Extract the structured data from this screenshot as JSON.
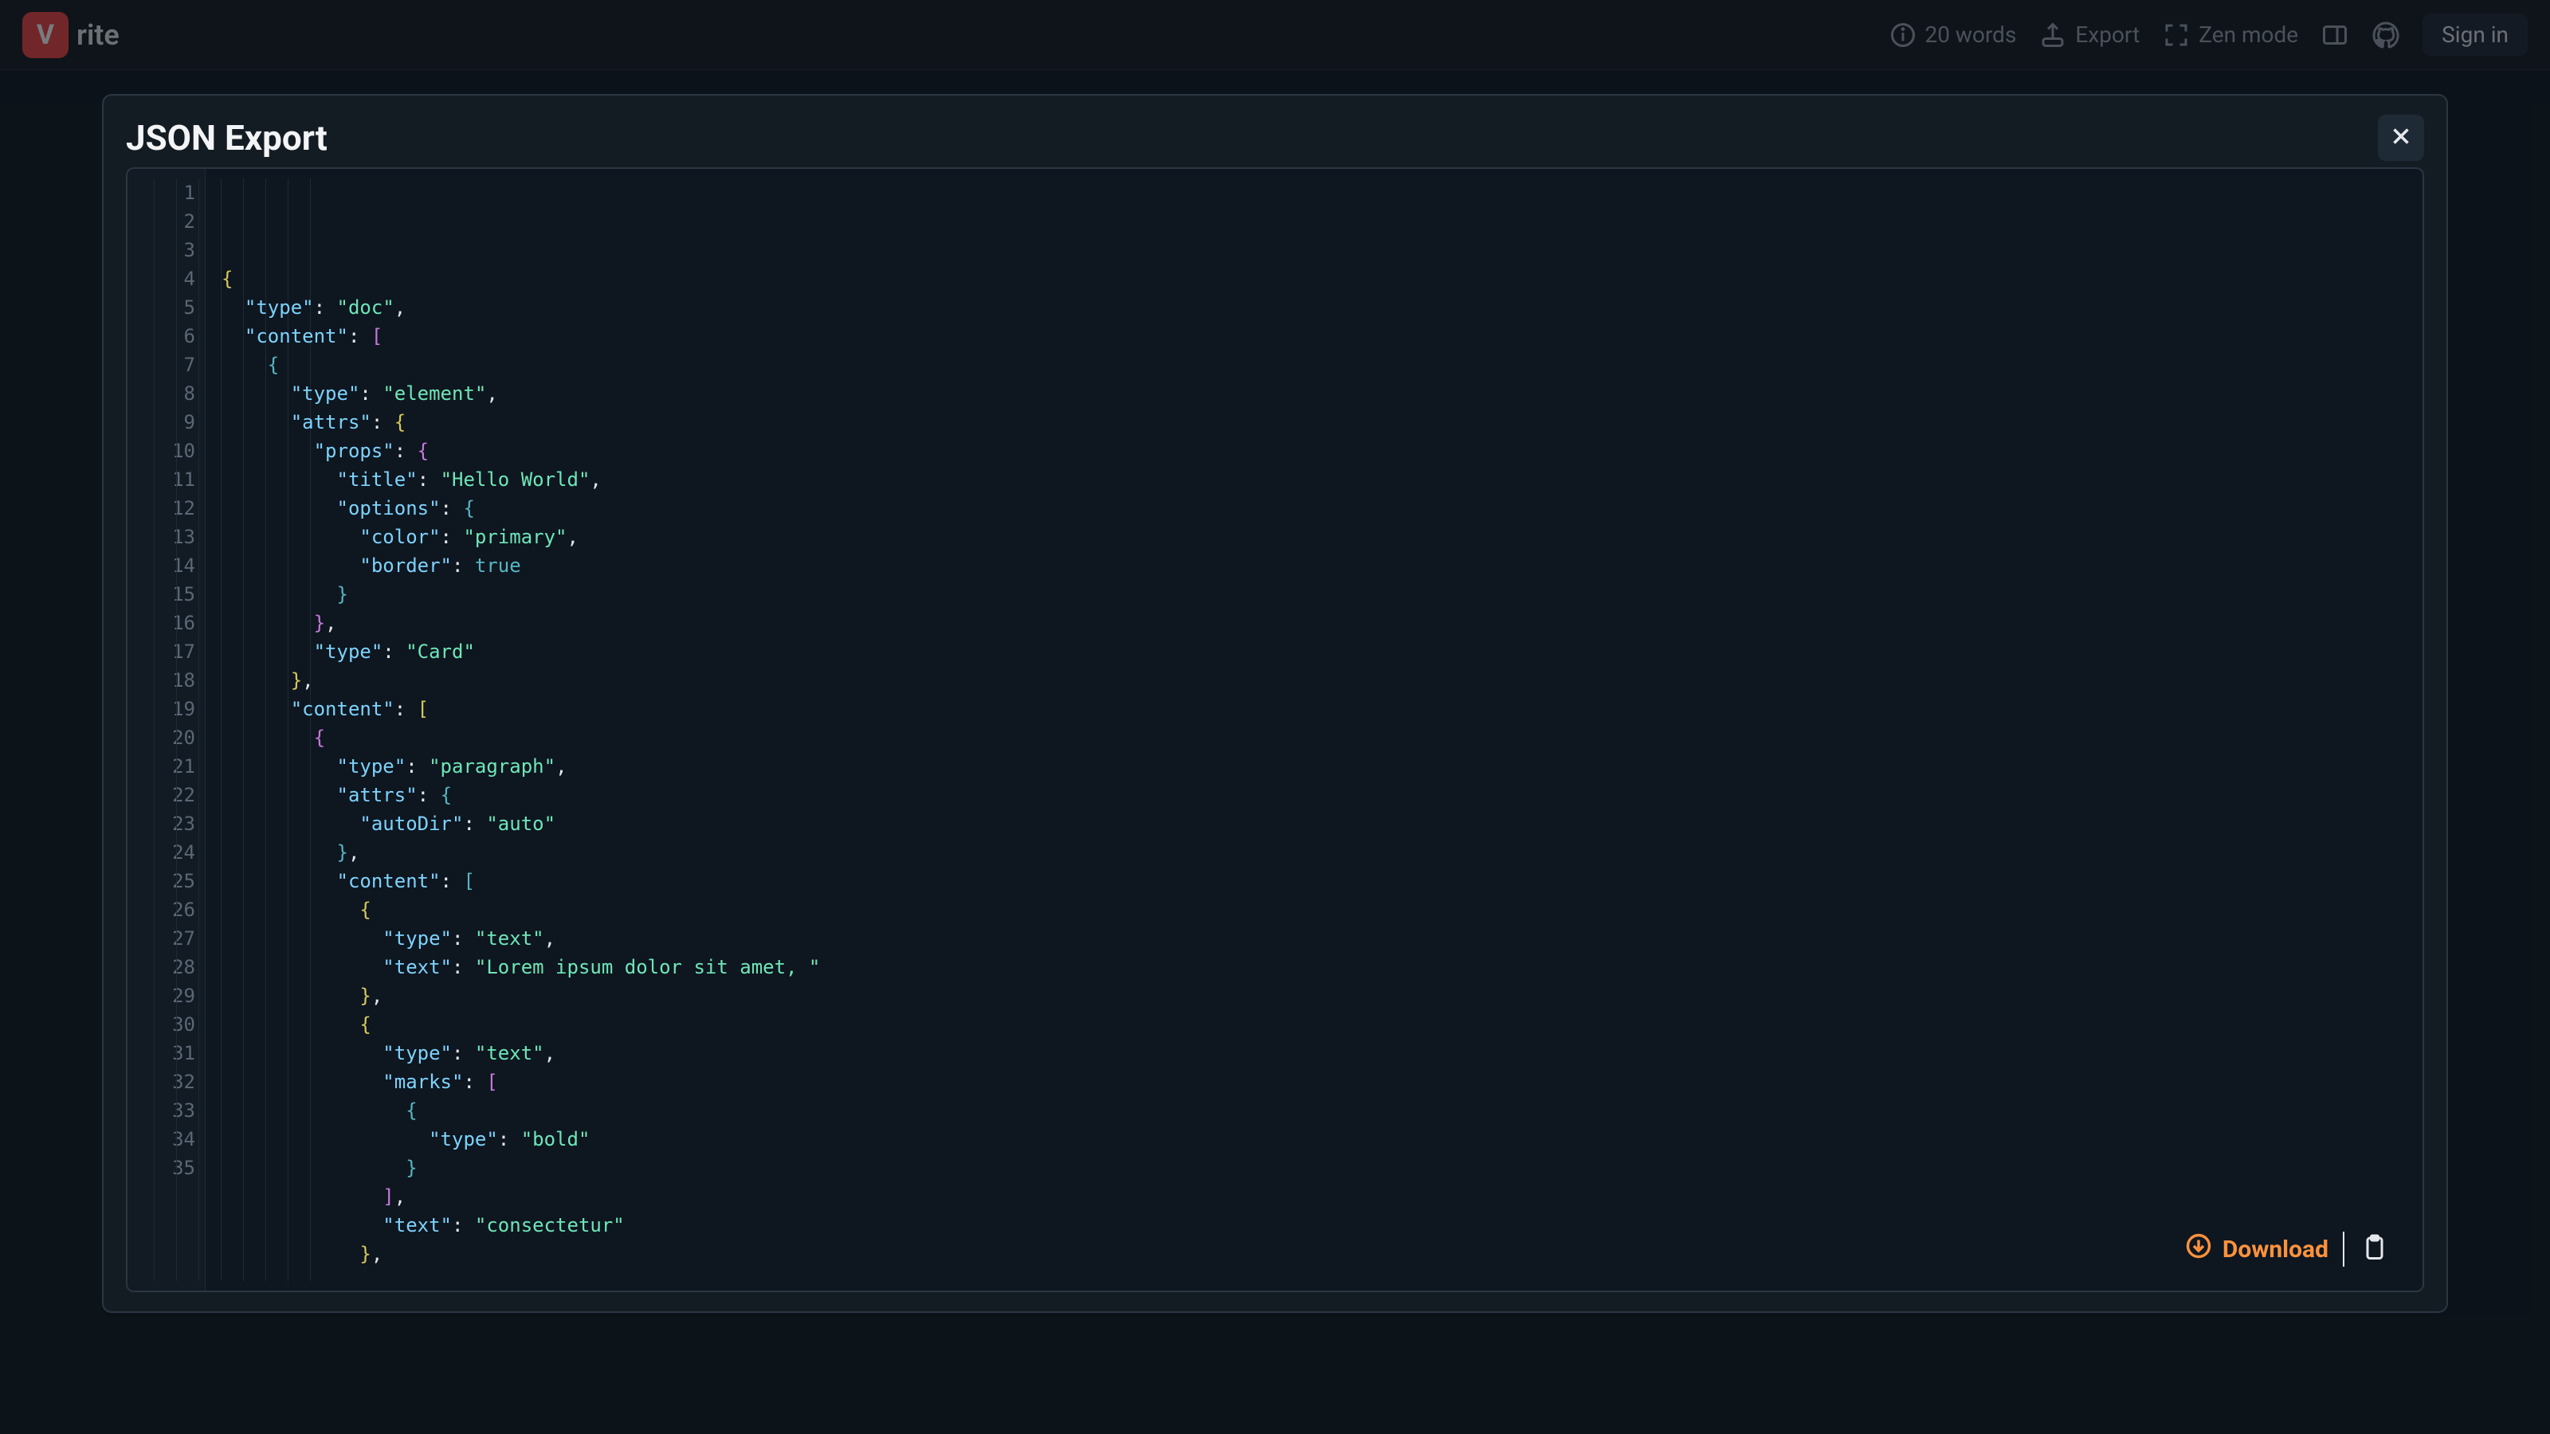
{
  "header": {
    "logo_letter": "V",
    "logo_text": "rite",
    "word_count": "20 words",
    "export_label": "Export",
    "zen_label": "Zen mode",
    "signin_label": "Sign in"
  },
  "modal": {
    "title": "JSON Export",
    "download_label": "Download"
  },
  "code": {
    "line_numbers": [
      "1",
      "2",
      "3",
      "4",
      "5",
      "6",
      "7",
      "8",
      "9",
      "10",
      "11",
      "12",
      "13",
      "14",
      "15",
      "16",
      "17",
      "18",
      "19",
      "20",
      "21",
      "22",
      "23",
      "24",
      "25",
      "26",
      "27",
      "28",
      "29",
      "30",
      "31",
      "32",
      "33",
      "34",
      "35"
    ],
    "lines": [
      [
        {
          "t": "{",
          "c": "brace"
        }
      ],
      [
        {
          "t": "  ",
          "c": "p"
        },
        {
          "t": "\"type\"",
          "c": "key"
        },
        {
          "t": ": ",
          "c": "punct"
        },
        {
          "t": "\"doc\"",
          "c": "str"
        },
        {
          "t": ",",
          "c": "punct"
        }
      ],
      [
        {
          "t": "  ",
          "c": "p"
        },
        {
          "t": "\"content\"",
          "c": "key"
        },
        {
          "t": ": ",
          "c": "punct"
        },
        {
          "t": "[",
          "c": "bracket"
        }
      ],
      [
        {
          "t": "    ",
          "c": "p"
        },
        {
          "t": "{",
          "c": "brace3"
        }
      ],
      [
        {
          "t": "      ",
          "c": "p"
        },
        {
          "t": "\"type\"",
          "c": "key"
        },
        {
          "t": ": ",
          "c": "punct"
        },
        {
          "t": "\"element\"",
          "c": "str"
        },
        {
          "t": ",",
          "c": "punct"
        }
      ],
      [
        {
          "t": "      ",
          "c": "p"
        },
        {
          "t": "\"attrs\"",
          "c": "key"
        },
        {
          "t": ": ",
          "c": "punct"
        },
        {
          "t": "{",
          "c": "brace"
        }
      ],
      [
        {
          "t": "        ",
          "c": "p"
        },
        {
          "t": "\"props\"",
          "c": "key"
        },
        {
          "t": ": ",
          "c": "punct"
        },
        {
          "t": "{",
          "c": "brace2"
        }
      ],
      [
        {
          "t": "          ",
          "c": "p"
        },
        {
          "t": "\"title\"",
          "c": "key"
        },
        {
          "t": ": ",
          "c": "punct"
        },
        {
          "t": "\"Hello World\"",
          "c": "str"
        },
        {
          "t": ",",
          "c": "punct"
        }
      ],
      [
        {
          "t": "          ",
          "c": "p"
        },
        {
          "t": "\"options\"",
          "c": "key"
        },
        {
          "t": ": ",
          "c": "punct"
        },
        {
          "t": "{",
          "c": "brace3"
        }
      ],
      [
        {
          "t": "            ",
          "c": "p"
        },
        {
          "t": "\"color\"",
          "c": "key"
        },
        {
          "t": ": ",
          "c": "punct"
        },
        {
          "t": "\"primary\"",
          "c": "str"
        },
        {
          "t": ",",
          "c": "punct"
        }
      ],
      [
        {
          "t": "            ",
          "c": "p"
        },
        {
          "t": "\"border\"",
          "c": "key"
        },
        {
          "t": ": ",
          "c": "punct"
        },
        {
          "t": "true",
          "c": "bool"
        }
      ],
      [
        {
          "t": "          ",
          "c": "p"
        },
        {
          "t": "}",
          "c": "brace3"
        }
      ],
      [
        {
          "t": "        ",
          "c": "p"
        },
        {
          "t": "}",
          "c": "brace2"
        },
        {
          "t": ",",
          "c": "punct"
        }
      ],
      [
        {
          "t": "        ",
          "c": "p"
        },
        {
          "t": "\"type\"",
          "c": "key"
        },
        {
          "t": ": ",
          "c": "punct"
        },
        {
          "t": "\"Card\"",
          "c": "str"
        }
      ],
      [
        {
          "t": "      ",
          "c": "p"
        },
        {
          "t": "}",
          "c": "brace"
        },
        {
          "t": ",",
          "c": "punct"
        }
      ],
      [
        {
          "t": "      ",
          "c": "p"
        },
        {
          "t": "\"content\"",
          "c": "key"
        },
        {
          "t": ": ",
          "c": "punct"
        },
        {
          "t": "[",
          "c": "brace"
        }
      ],
      [
        {
          "t": "        ",
          "c": "p"
        },
        {
          "t": "{",
          "c": "brace2"
        }
      ],
      [
        {
          "t": "          ",
          "c": "p"
        },
        {
          "t": "\"type\"",
          "c": "key"
        },
        {
          "t": ": ",
          "c": "punct"
        },
        {
          "t": "\"paragraph\"",
          "c": "str"
        },
        {
          "t": ",",
          "c": "punct"
        }
      ],
      [
        {
          "t": "          ",
          "c": "p"
        },
        {
          "t": "\"attrs\"",
          "c": "key"
        },
        {
          "t": ": ",
          "c": "punct"
        },
        {
          "t": "{",
          "c": "brace3"
        }
      ],
      [
        {
          "t": "            ",
          "c": "p"
        },
        {
          "t": "\"autoDir\"",
          "c": "key"
        },
        {
          "t": ": ",
          "c": "punct"
        },
        {
          "t": "\"auto\"",
          "c": "str"
        }
      ],
      [
        {
          "t": "          ",
          "c": "p"
        },
        {
          "t": "}",
          "c": "brace3"
        },
        {
          "t": ",",
          "c": "punct"
        }
      ],
      [
        {
          "t": "          ",
          "c": "p"
        },
        {
          "t": "\"content\"",
          "c": "key"
        },
        {
          "t": ": ",
          "c": "punct"
        },
        {
          "t": "[",
          "c": "brace3"
        }
      ],
      [
        {
          "t": "            ",
          "c": "p"
        },
        {
          "t": "{",
          "c": "brace"
        }
      ],
      [
        {
          "t": "              ",
          "c": "p"
        },
        {
          "t": "\"type\"",
          "c": "key"
        },
        {
          "t": ": ",
          "c": "punct"
        },
        {
          "t": "\"text\"",
          "c": "str"
        },
        {
          "t": ",",
          "c": "punct"
        }
      ],
      [
        {
          "t": "              ",
          "c": "p"
        },
        {
          "t": "\"text\"",
          "c": "key"
        },
        {
          "t": ": ",
          "c": "punct"
        },
        {
          "t": "\"Lorem ipsum dolor sit amet, \"",
          "c": "str"
        }
      ],
      [
        {
          "t": "            ",
          "c": "p"
        },
        {
          "t": "}",
          "c": "brace"
        },
        {
          "t": ",",
          "c": "punct"
        }
      ],
      [
        {
          "t": "            ",
          "c": "p"
        },
        {
          "t": "{",
          "c": "brace"
        }
      ],
      [
        {
          "t": "              ",
          "c": "p"
        },
        {
          "t": "\"type\"",
          "c": "key"
        },
        {
          "t": ": ",
          "c": "punct"
        },
        {
          "t": "\"text\"",
          "c": "str"
        },
        {
          "t": ",",
          "c": "punct"
        }
      ],
      [
        {
          "t": "              ",
          "c": "p"
        },
        {
          "t": "\"marks\"",
          "c": "key"
        },
        {
          "t": ": ",
          "c": "punct"
        },
        {
          "t": "[",
          "c": "bracket"
        }
      ],
      [
        {
          "t": "                ",
          "c": "p"
        },
        {
          "t": "{",
          "c": "brace3"
        }
      ],
      [
        {
          "t": "                  ",
          "c": "p"
        },
        {
          "t": "\"type\"",
          "c": "key"
        },
        {
          "t": ": ",
          "c": "punct"
        },
        {
          "t": "\"bold\"",
          "c": "str"
        }
      ],
      [
        {
          "t": "                ",
          "c": "p"
        },
        {
          "t": "}",
          "c": "brace3"
        }
      ],
      [
        {
          "t": "              ",
          "c": "p"
        },
        {
          "t": "]",
          "c": "bracket"
        },
        {
          "t": ",",
          "c": "punct"
        }
      ],
      [
        {
          "t": "              ",
          "c": "p"
        },
        {
          "t": "\"text\"",
          "c": "key"
        },
        {
          "t": ": ",
          "c": "punct"
        },
        {
          "t": "\"consectetur\"",
          "c": "str"
        }
      ],
      [
        {
          "t": "            ",
          "c": "p"
        },
        {
          "t": "}",
          "c": "brace"
        },
        {
          "t": ",",
          "c": "punct"
        }
      ]
    ]
  }
}
